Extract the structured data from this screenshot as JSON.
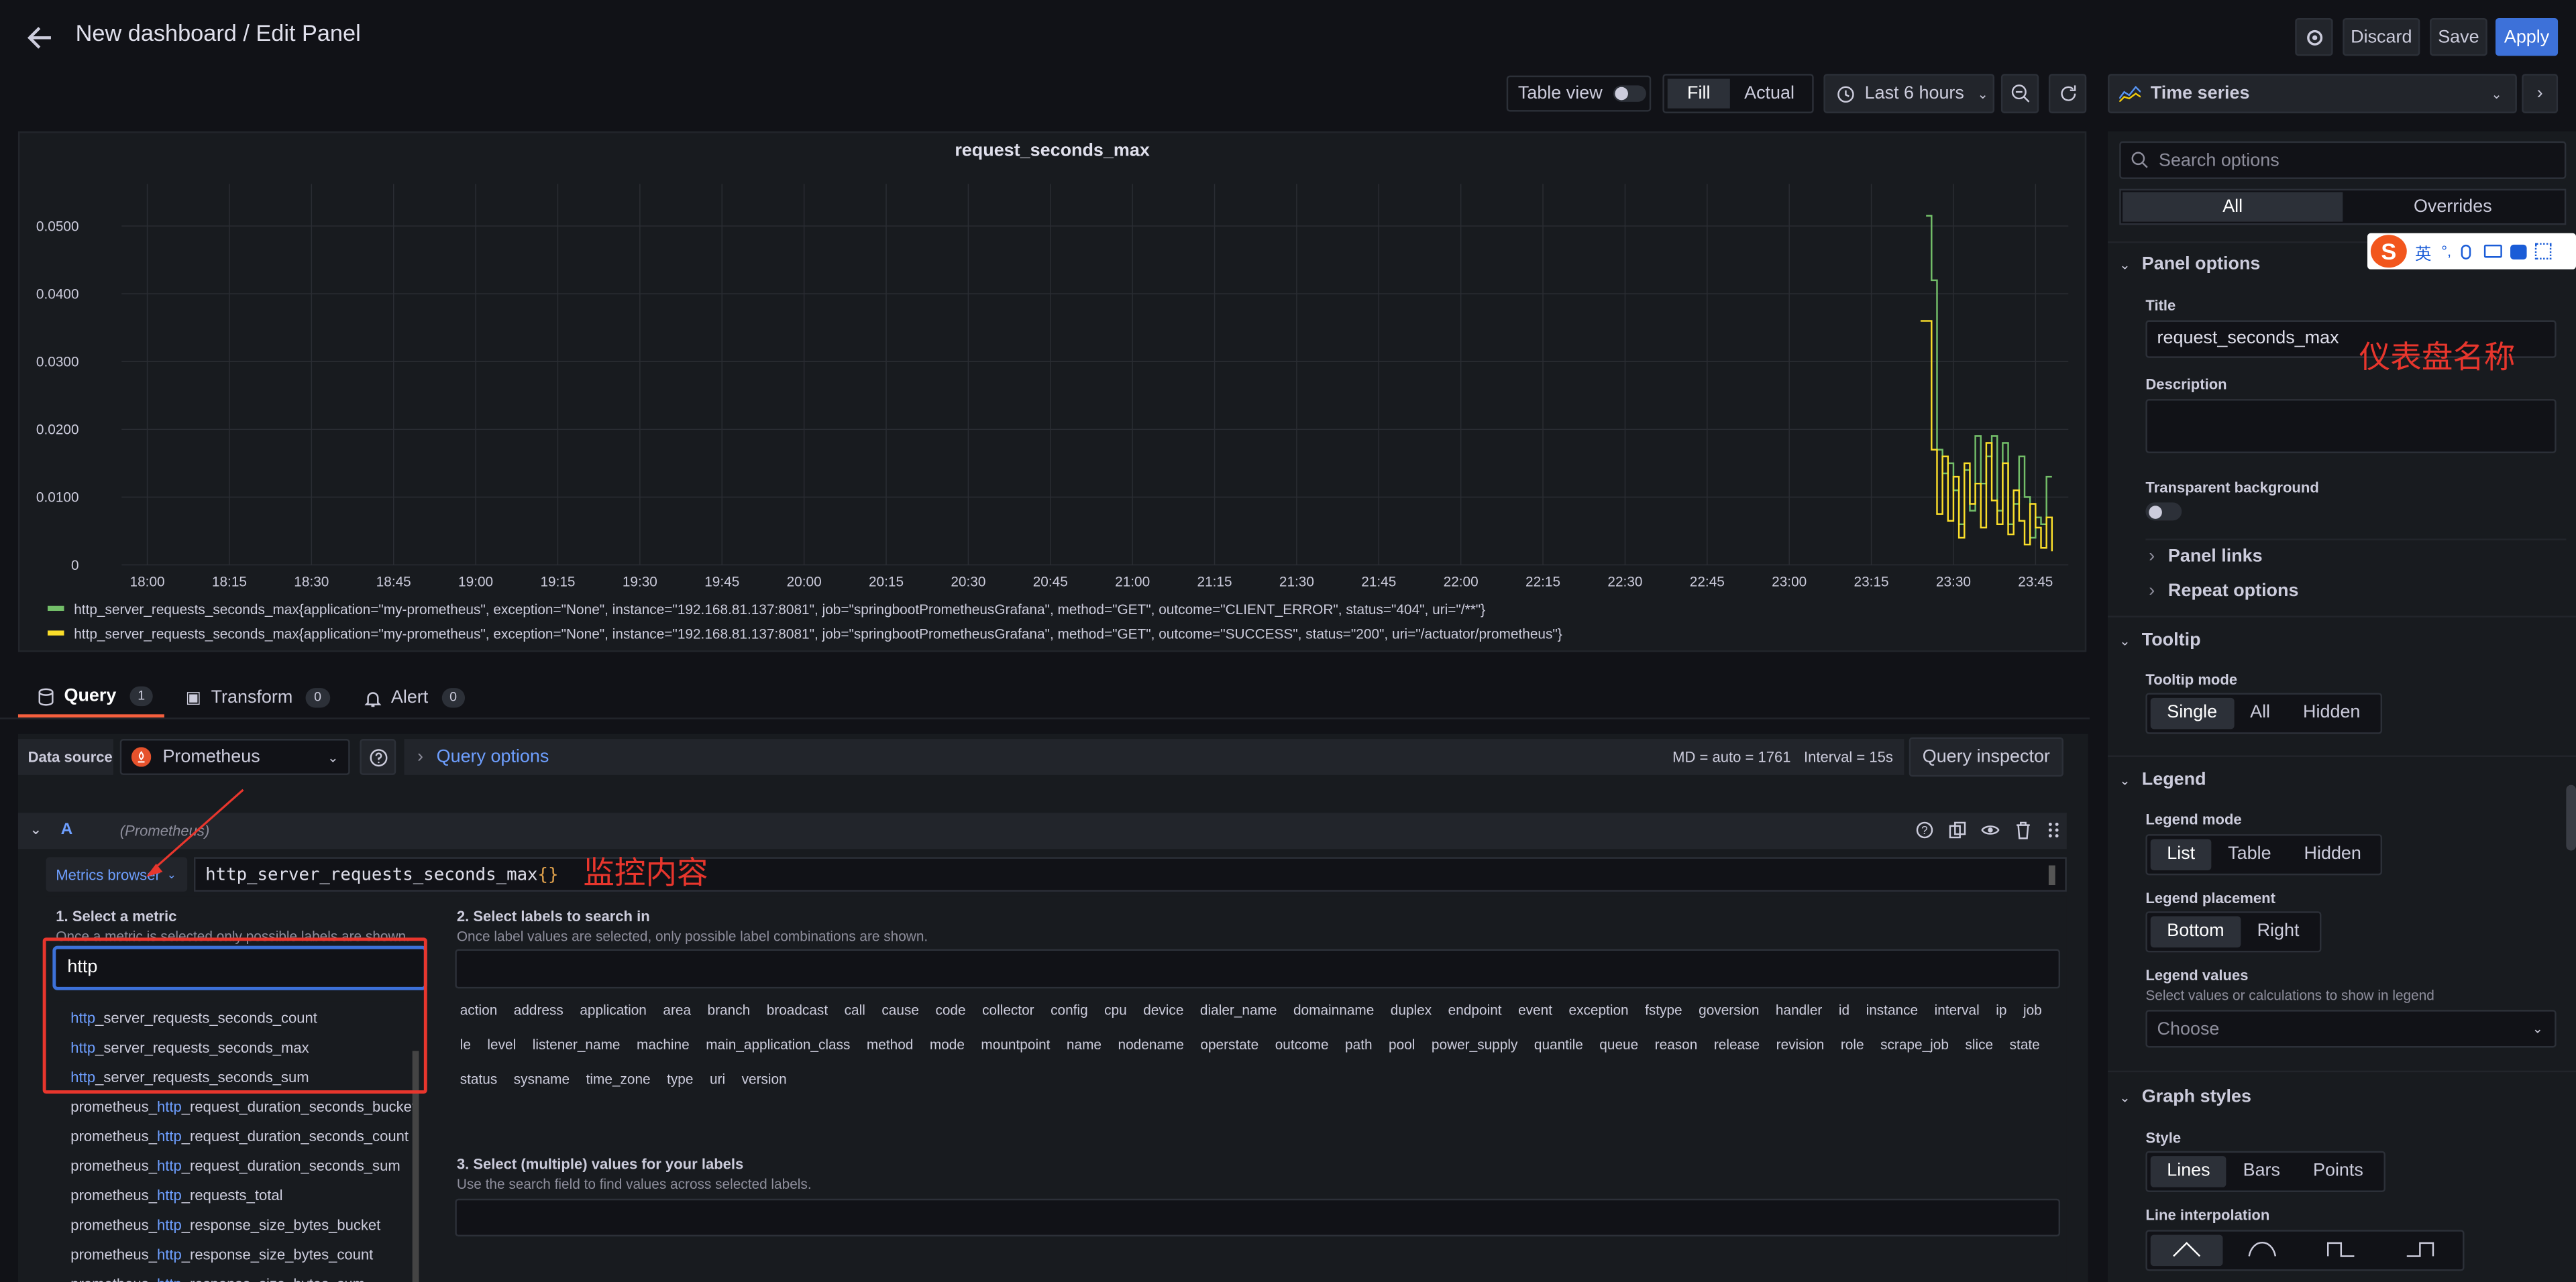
{
  "header": {
    "title": "New dashboard / Edit Panel",
    "discard": "Discard",
    "save": "Save",
    "apply": "Apply"
  },
  "toolbar": {
    "table_view": "Table view",
    "fill": "Fill",
    "actual": "Actual",
    "time_range": "Last 6 hours"
  },
  "chart_data": {
    "type": "line",
    "title": "request_seconds_max",
    "x_ticks": [
      "18:00",
      "18:15",
      "18:30",
      "18:45",
      "19:00",
      "19:15",
      "19:30",
      "19:45",
      "20:00",
      "20:15",
      "20:30",
      "20:45",
      "21:00",
      "21:15",
      "21:30",
      "21:45",
      "22:00",
      "22:15",
      "22:30",
      "22:45",
      "23:00",
      "23:15",
      "23:30",
      "23:45"
    ],
    "y_ticks": [
      "0.0500",
      "0.0400",
      "0.0300",
      "0.0200",
      "0.0100",
      "0"
    ],
    "ylim": [
      0,
      0.055
    ],
    "series": [
      {
        "name": "http_server_requests_seconds_max{application=\"my-prometheus\", exception=\"None\", instance=\"192.168.81.137:8081\", job=\"springbootPrometheusGrafana\", method=\"GET\", outcome=\"CLIENT_ERROR\", status=\"404\", uri=\"/**\"}",
        "color": "#73bf69",
        "x": [
          "23:25",
          "23:26",
          "23:26",
          "23:27",
          "23:28",
          "23:29",
          "23:30",
          "23:31",
          "23:32",
          "23:33",
          "23:34",
          "23:35",
          "23:36",
          "23:37",
          "23:38",
          "23:39",
          "23:40",
          "23:41",
          "23:42",
          "23:43",
          "23:44",
          "23:45",
          "23:46",
          "23:47",
          "23:48"
        ],
        "values": [
          0.0515,
          0.0515,
          0.042,
          0.017,
          0.0135,
          0.015,
          0.011,
          0.006,
          0.014,
          0.008,
          0.019,
          0.012,
          0.016,
          0.019,
          0.008,
          0.018,
          0.006,
          0.009,
          0.016,
          0.01,
          0.004,
          0.007,
          0.006,
          0.013,
          0.013
        ]
      },
      {
        "name": "http_server_requests_seconds_max{application=\"my-prometheus\", exception=\"None\", instance=\"192.168.81.137:8081\", job=\"springbootPrometheusGrafana\", method=\"GET\", outcome=\"SUCCESS\", status=\"200\", uri=\"/actuator/prometheus\"}",
        "color": "#fade2a",
        "x": [
          "23:24",
          "23:25",
          "23:26",
          "23:27",
          "23:28",
          "23:29",
          "23:30",
          "23:31",
          "23:32",
          "23:33",
          "23:34",
          "23:35",
          "23:36",
          "23:37",
          "23:38",
          "23:39",
          "23:40",
          "23:41",
          "23:42",
          "23:43",
          "23:44",
          "23:45",
          "23:46",
          "23:47",
          "23:48"
        ],
        "values": [
          0.036,
          0.036,
          0.017,
          0.0075,
          0.016,
          0.0065,
          0.013,
          0.004,
          0.015,
          0.009,
          0.012,
          0.0055,
          0.018,
          0.0095,
          0.006,
          0.015,
          0.0045,
          0.011,
          0.0065,
          0.003,
          0.009,
          0.0055,
          0.0025,
          0.007,
          0.002
        ]
      }
    ]
  },
  "tabs": {
    "query": "Query",
    "query_count": "1",
    "transform": "Transform",
    "transform_count": "0",
    "alert": "Alert",
    "alert_count": "0"
  },
  "datasource": {
    "label": "Data source",
    "name": "Prometheus",
    "query_options": "Query options",
    "md": "MD = auto = 1761",
    "interval": "Interval = 15s",
    "inspector": "Query inspector"
  },
  "query": {
    "ref": "A",
    "ds_hint": "(Prometheus)",
    "metrics_browser": "Metrics browser",
    "expr": "http_server_requests_seconds_max",
    "expr_braces": "{}",
    "annotation_expr": "监控内容"
  },
  "browser": {
    "step1_title": "1. Select a metric",
    "step1_sub": "Once a metric is selected only possible labels are shown.",
    "search_value": "http",
    "metrics": [
      {
        "pre": "",
        "hl": "http",
        "post": "_server_requests_seconds_count"
      },
      {
        "pre": "",
        "hl": "http",
        "post": "_server_requests_seconds_max"
      },
      {
        "pre": "",
        "hl": "http",
        "post": "_server_requests_seconds_sum"
      },
      {
        "pre": "prometheus_",
        "hl": "http",
        "post": "_request_duration_seconds_bucket"
      },
      {
        "pre": "prometheus_",
        "hl": "http",
        "post": "_request_duration_seconds_count"
      },
      {
        "pre": "prometheus_",
        "hl": "http",
        "post": "_request_duration_seconds_sum"
      },
      {
        "pre": "prometheus_",
        "hl": "http",
        "post": "_requests_total"
      },
      {
        "pre": "prometheus_",
        "hl": "http",
        "post": "_response_size_bytes_bucket"
      },
      {
        "pre": "prometheus_",
        "hl": "http",
        "post": "_response_size_bytes_count"
      },
      {
        "pre": "prometheus_",
        "hl": "http",
        "post": "_response_size_bytes_sum"
      }
    ],
    "step2_title": "2. Select labels to search in",
    "step2_sub": "Once label values are selected, only possible label combinations are shown.",
    "labels": [
      "action",
      "address",
      "application",
      "area",
      "branch",
      "broadcast",
      "call",
      "cause",
      "code",
      "collector",
      "config",
      "cpu",
      "device",
      "dialer_name",
      "domainname",
      "duplex",
      "endpoint",
      "event",
      "exception",
      "fstype",
      "goversion",
      "handler",
      "id",
      "instance",
      "interval",
      "ip",
      "job",
      "le",
      "level",
      "listener_name",
      "machine",
      "main_application_class",
      "method",
      "mode",
      "mountpoint",
      "name",
      "nodename",
      "operstate",
      "outcome",
      "path",
      "pool",
      "power_supply",
      "quantile",
      "queue",
      "reason",
      "release",
      "revision",
      "role",
      "scrape_job",
      "slice",
      "state",
      "status",
      "sysname",
      "time_zone",
      "type",
      "uri",
      "version"
    ],
    "step3_title": "3. Select (multiple) values for your labels",
    "step3_sub": "Use the search field to find values across selected labels."
  },
  "options": {
    "viz": "Time series",
    "search_placeholder": "Search options",
    "all": "All",
    "overrides": "Overrides",
    "panel_options": "Panel options",
    "title_label": "Title",
    "title_value": "request_seconds_max",
    "annotation_title": "仪表盘名称",
    "description": "Description",
    "transparent": "Transparent background",
    "panel_links": "Panel links",
    "repeat": "Repeat options",
    "tooltip": "Tooltip",
    "tooltip_mode": "Tooltip mode",
    "single": "Single",
    "tt_all": "All",
    "hidden": "Hidden",
    "legend": "Legend",
    "legend_mode": "Legend mode",
    "list": "List",
    "table": "Table",
    "lg_hidden": "Hidden",
    "legend_placement": "Legend placement",
    "bottom": "Bottom",
    "right": "Right",
    "legend_values": "Legend values",
    "legend_values_sub": "Select values or calculations to show in legend",
    "choose": "Choose",
    "graph_styles": "Graph styles",
    "style": "Style",
    "lines": "Lines",
    "bars": "Bars",
    "points": "Points",
    "line_interp": "Line interpolation"
  },
  "ime": {
    "lang": "英",
    "punct": "°,"
  }
}
